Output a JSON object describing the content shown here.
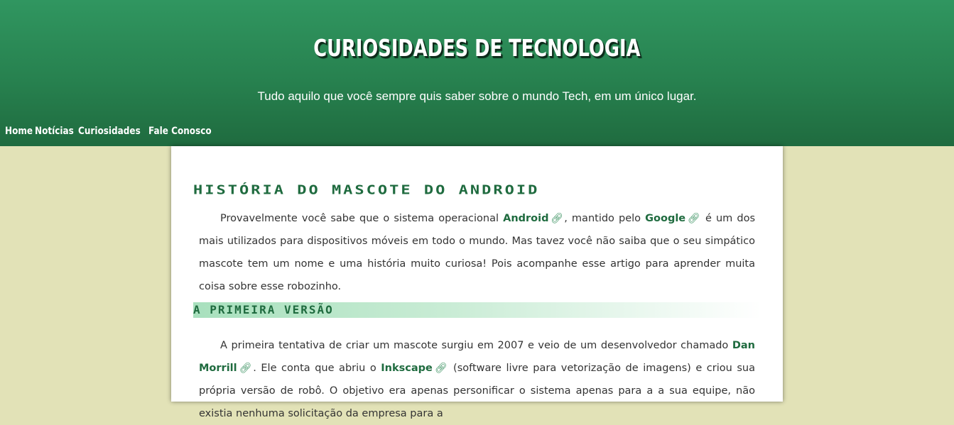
{
  "header": {
    "title": "CURIOSIDADES DE TECNOLOGIA",
    "subtitle": "Tudo aquilo que você sempre quis saber sobre o mundo Tech, em um único lugar."
  },
  "nav": {
    "items": [
      "Home",
      "Notícias",
      "Curiosidades",
      "Fale Conosco"
    ]
  },
  "post": {
    "title": "História do Mascote do Android",
    "intro": {
      "t1": "Provavelmente você sabe que o sistema operacional ",
      "link1": "Android",
      "t2": ", mantido pelo ",
      "link2": "Google",
      "t3": " é um dos mais utilizados para dispositivos móveis em todo o mundo. Mas tavez você não saiba que o seu simpático mascote tem um nome e uma história muito curiosa! Pois acompanhe esse artigo para aprender muita coisa sobre esse robozinho."
    },
    "section1": {
      "title": "A Primeira Versão",
      "t1": "A primeira tentativa de criar um mascote surgiu em 2007 e veio de um desenvolvedor chamado ",
      "link1": "Dan Morrill",
      "t2": ". Ele conta que abriu o ",
      "link2": "Inkscape",
      "t3": " (software livre para vetorização de imagens) e criou sua própria versão de robô. O objetivo era apenas personificar o sistema apenas para a a sua equipe, não existia nenhuma solicitação da empresa para a"
    },
    "link_icon": "external-link-icon"
  },
  "colors": {
    "header_green": "#27814f",
    "page_bg": "#e2e2b7",
    "title_green": "#1f6b3f"
  }
}
